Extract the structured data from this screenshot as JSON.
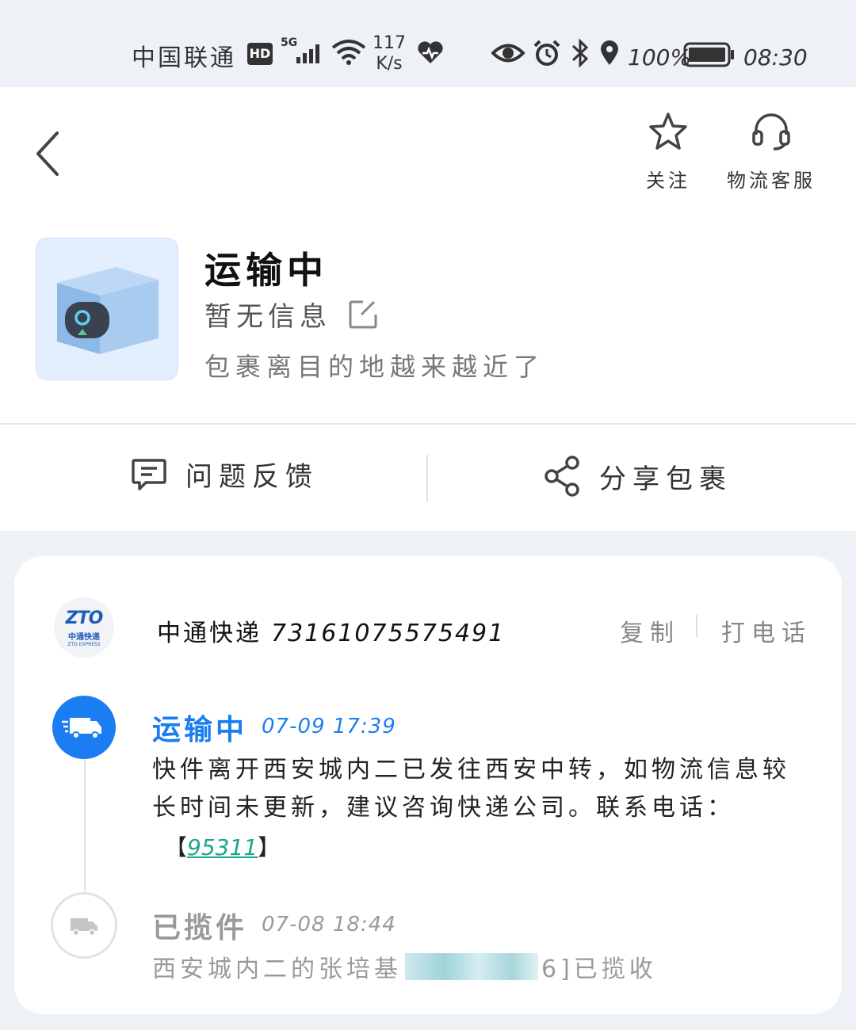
{
  "status_bar": {
    "carrier": "中国联通",
    "hd": "HD",
    "network": "5G",
    "speed_value": "117",
    "speed_unit": "K/s",
    "battery": "100%",
    "time": "08:30"
  },
  "header": {
    "follow_label": "关注",
    "service_label": "物流客服"
  },
  "package": {
    "status": "运输中",
    "name": "暂无信息",
    "description": "包裹离目的地越来越近了"
  },
  "actions": {
    "feedback_label": "问题反馈",
    "share_label": "分享包裹"
  },
  "shipment": {
    "logo_big": "ZTO",
    "logo_cn": "中通快递",
    "logo_en": "ZTO EXPRESS",
    "courier": "中通快递",
    "tracking_number": "73161075575491",
    "copy_label": "复制",
    "call_label": "打电话"
  },
  "timeline": [
    {
      "status": "运输中",
      "time": "07-09  17:39",
      "description": "快件离开西安城内二已发往西安中转，如物流信息较长时间未更新，建议咨询快递公司。联系电话：",
      "phone_open": "【",
      "phone": "95311",
      "phone_close": "】"
    },
    {
      "status": "已揽件",
      "time": "07-08  18:44",
      "description_prefix": "西安城内二的张培基",
      "description_suffix": "6]已揽收"
    }
  ],
  "colors": {
    "accent": "#1a7ef2",
    "phone_link": "#1aa58c",
    "background": "#eef1f6"
  }
}
